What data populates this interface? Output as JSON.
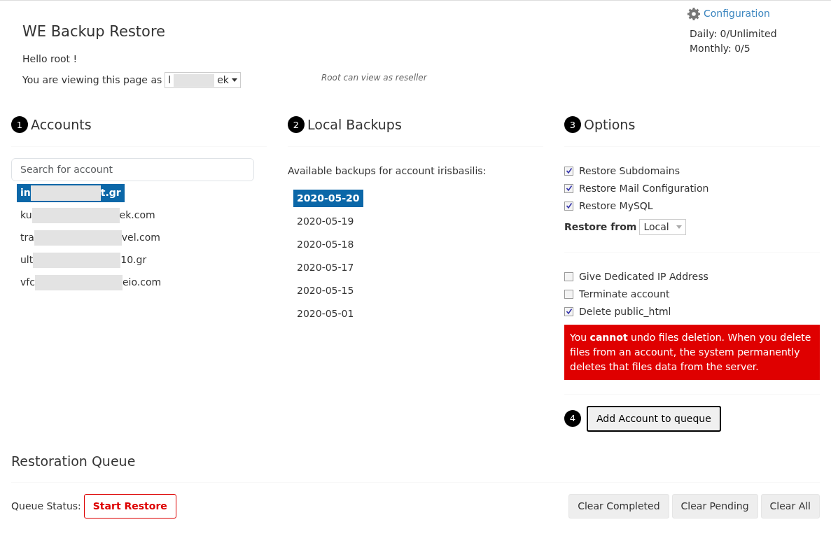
{
  "header": {
    "title": "WE Backup Restore",
    "greeting": "Hello root !",
    "viewing_label": "You are viewing this page as",
    "viewing_as": {
      "start": "l",
      "end": "ek"
    },
    "note": "Root can view as reseller"
  },
  "config": {
    "link": "Configuration",
    "daily": "Daily: 0/Unlimited",
    "monthly": "Monthly: 0/5"
  },
  "steps": [
    {
      "number": "1",
      "title": "Accounts"
    },
    {
      "number": "2",
      "title": "Local Backups"
    },
    {
      "number": "3",
      "title": "Options"
    }
  ],
  "accounts": {
    "placeholder": "Search for account",
    "items": [
      {
        "start": "in",
        "end": "t.gr",
        "selected": true
      },
      {
        "start": "ku",
        "end": "ek.com",
        "selected": false
      },
      {
        "start": "tra",
        "end": "vel.com",
        "selected": false
      },
      {
        "start": "ult",
        "end": "10.gr",
        "selected": false
      },
      {
        "start": "vfc",
        "end": "eio.com",
        "selected": false
      }
    ]
  },
  "backups": {
    "caption": "Available backups for account irisbasilis:",
    "items": [
      {
        "date": "2020-05-20",
        "selected": true
      },
      {
        "date": "2020-05-19",
        "selected": false
      },
      {
        "date": "2020-05-18",
        "selected": false
      },
      {
        "date": "2020-05-17",
        "selected": false
      },
      {
        "date": "2020-05-15",
        "selected": false
      },
      {
        "date": "2020-05-01",
        "selected": false
      }
    ]
  },
  "options": {
    "restore": [
      {
        "label": "Restore Subdomains",
        "checked": true
      },
      {
        "label": "Restore Mail Configuration",
        "checked": true
      },
      {
        "label": "Restore MySQL",
        "checked": true
      }
    ],
    "restore_from_label": "Restore from",
    "restore_from": "Local",
    "extra": [
      {
        "label": "Give Dedicated IP Address",
        "checked": false
      },
      {
        "label": "Terminate account",
        "checked": false
      },
      {
        "label": "Delete public_html",
        "checked": true
      }
    ],
    "warning": "You **cannot** undo files deletion. When you delete files from an account, the system permanently deletes that files data from the server.",
    "step_number": "4",
    "add_button": "Add Account to queque"
  },
  "queue": {
    "title": "Restoration Queue",
    "status_label": "Queue Status:",
    "start_button": "Start Restore",
    "buttons": [
      "Clear Completed",
      "Clear Pending",
      "Clear All"
    ]
  }
}
